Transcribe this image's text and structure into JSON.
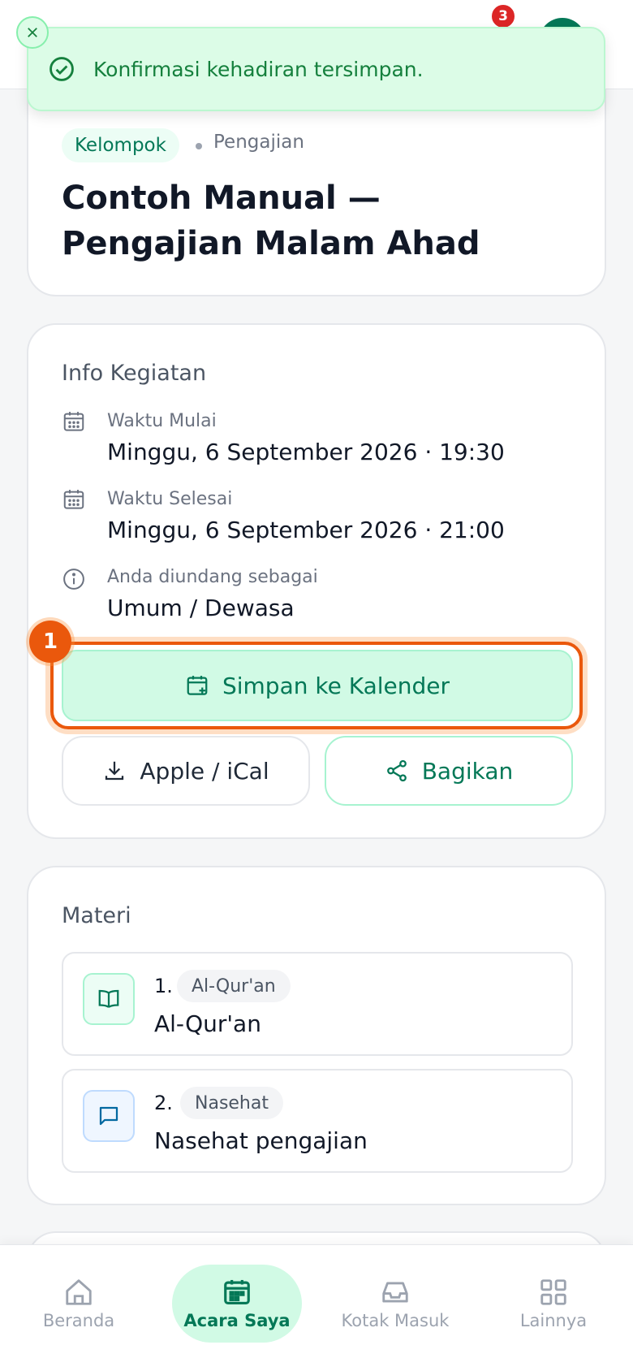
{
  "header": {
    "notification_count": "3"
  },
  "toast": {
    "message": "Konfirmasi kehadiran tersimpan."
  },
  "event": {
    "tag": "Kelompok",
    "category": "Pengajian",
    "title": "Contoh Manual — Pengajian Malam Ahad"
  },
  "info": {
    "section_title": "Info Kegiatan",
    "start_label": "Waktu Mulai",
    "start_value": "Minggu, 6 September 2026 · 19:30",
    "end_label": "Waktu Selesai",
    "end_value": "Minggu, 6 September 2026 · 21:00",
    "invite_label": "Anda diundang sebagai",
    "invite_value": "Umum / Dewasa",
    "step_number": "1",
    "save_calendar_label": "Simpan ke Kalender",
    "ical_label": "Apple / iCal",
    "share_label": "Bagikan"
  },
  "materi": {
    "section_title": "Materi",
    "items": [
      {
        "num": "1.",
        "tag": "Al-Qur'an",
        "text": "Al-Qur'an",
        "icon": "book-icon"
      },
      {
        "num": "2.",
        "tag": "Nasehat",
        "text": "Nasehat pengajian",
        "icon": "message-icon"
      }
    ]
  },
  "nav": {
    "items": [
      {
        "label": "Beranda",
        "icon": "home-icon"
      },
      {
        "label": "Acara Saya",
        "icon": "calendar-icon"
      },
      {
        "label": "Kotak Masuk",
        "icon": "inbox-icon"
      },
      {
        "label": "Lainnya",
        "icon": "grid-icon"
      }
    ]
  },
  "colors": {
    "primary": "#047857",
    "primary_light": "#d1fae5",
    "highlight": "#ea580c",
    "badge": "#dc2626"
  }
}
